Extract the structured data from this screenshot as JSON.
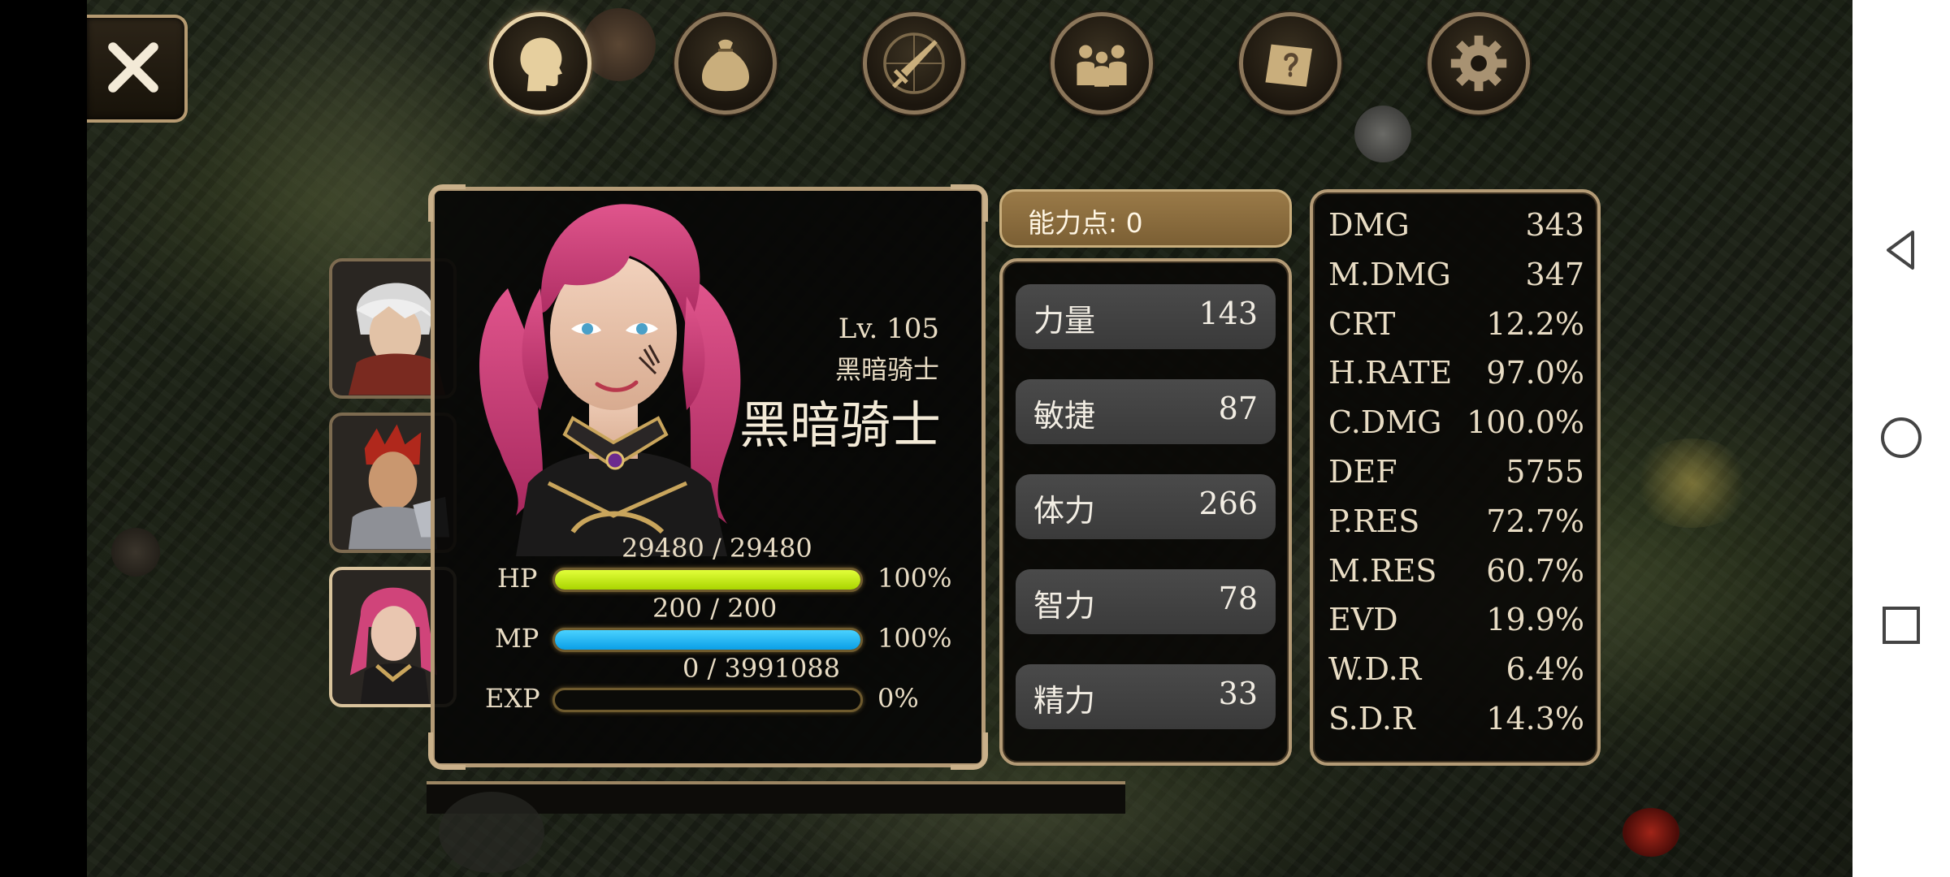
{
  "top_menu": [
    {
      "id": "character",
      "icon": "head-icon",
      "active": true
    },
    {
      "id": "inventory",
      "icon": "bag-icon",
      "active": false
    },
    {
      "id": "skills",
      "icon": "sword-icon",
      "active": false
    },
    {
      "id": "party",
      "icon": "group-icon",
      "active": false
    },
    {
      "id": "quests",
      "icon": "scroll-icon",
      "active": false
    },
    {
      "id": "settings",
      "icon": "gear-icon",
      "active": false
    }
  ],
  "character": {
    "level": "Lv. 105",
    "class_small": "黑暗骑士",
    "class_large": "黑暗骑士",
    "hp": {
      "label": "HP",
      "value": "29480 / 29480",
      "percent": "100%",
      "fill": 1.0,
      "color": "#c8f000"
    },
    "mp": {
      "label": "MP",
      "value": "200 / 200",
      "percent": "100%",
      "fill": 1.0,
      "color": "#1ab8ff"
    },
    "exp": {
      "label": "EXP",
      "value": "0 / 3991088",
      "percent": "0%",
      "fill": 0.0
    }
  },
  "ability_points": "能力点: 0",
  "stats": [
    {
      "name": "力量",
      "value": "143"
    },
    {
      "name": "敏捷",
      "value": "87"
    },
    {
      "name": "体力",
      "value": "266"
    },
    {
      "name": "智力",
      "value": "78"
    },
    {
      "name": "精力",
      "value": "33"
    }
  ],
  "secondary_stats": [
    {
      "name": "DMG",
      "value": "343"
    },
    {
      "name": "M.DMG",
      "value": "347"
    },
    {
      "name": "CRT",
      "value": "12.2%"
    },
    {
      "name": "H.RATE",
      "value": "97.0%"
    },
    {
      "name": "C.DMG",
      "value": "100.0%"
    },
    {
      "name": "DEF",
      "value": "5755"
    },
    {
      "name": "P.RES",
      "value": "72.7%"
    },
    {
      "name": "M.RES",
      "value": "60.7%"
    },
    {
      "name": "EVD",
      "value": "19.9%"
    },
    {
      "name": "W.D.R",
      "value": "6.4%"
    },
    {
      "name": "S.D.R",
      "value": "14.3%"
    }
  ],
  "colors": {
    "frame": "#b49b76",
    "accent": "#8a6d3f",
    "text": "#e8dcc4"
  }
}
